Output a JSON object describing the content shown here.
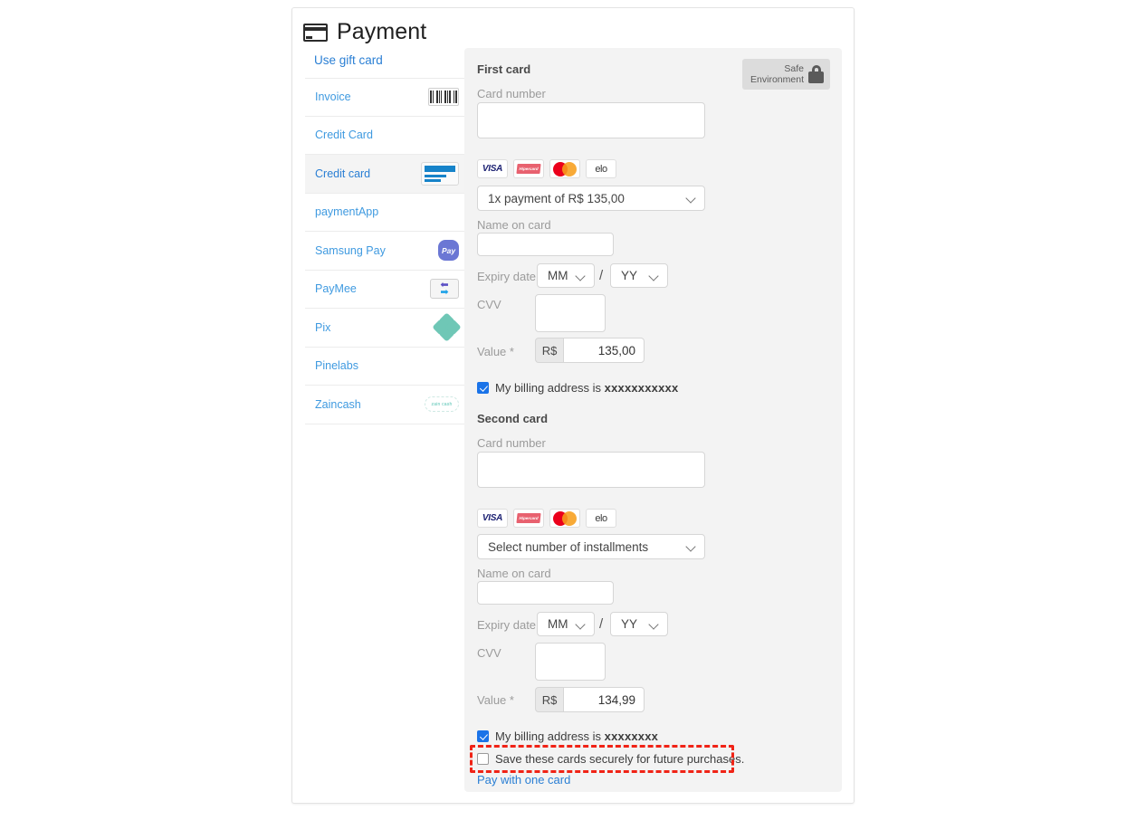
{
  "header": {
    "title": "Payment",
    "icon": "credit-card-icon"
  },
  "gift_card_link": "Use gift card",
  "sidebar": {
    "items": [
      {
        "label": "Invoice",
        "icon": "barcode-icon",
        "selected": false
      },
      {
        "label": "Credit Card",
        "icon": "none",
        "selected": false
      },
      {
        "label": "Credit card",
        "icon": "credit-card-icon",
        "selected": true
      },
      {
        "label": "paymentApp",
        "icon": "none",
        "selected": false
      },
      {
        "label": "Samsung Pay",
        "icon": "samsung-pay-icon",
        "icon_text": "Pay",
        "selected": false
      },
      {
        "label": "PayMee",
        "icon": "paymee-arrows-icon",
        "selected": false
      },
      {
        "label": "Pix",
        "icon": "pix-icon",
        "selected": false
      },
      {
        "label": "Pinelabs",
        "icon": "none",
        "selected": false
      },
      {
        "label": "Zaincash",
        "icon": "zaincash-icon",
        "icon_text": "zain cash",
        "selected": false
      }
    ]
  },
  "safe_badge": {
    "line1": "Safe",
    "line2": "Environment",
    "icon": "lock-icon"
  },
  "brands": [
    {
      "name": "visa-logo",
      "text": "VISA"
    },
    {
      "name": "hipercard-logo",
      "text": "Hipercard"
    },
    {
      "name": "mastercard-logo",
      "text": ""
    },
    {
      "name": "elo-logo",
      "text": "elo"
    }
  ],
  "first_card": {
    "title": "First card",
    "card_number_label": "Card number",
    "card_number_value": "",
    "selected_brand_index": 0,
    "installments_value": "1x payment of R$ 135,00",
    "name_label": "Name on card",
    "name_value": "",
    "expiry_label": "Expiry date",
    "expiry_month": "MM",
    "expiry_year": "YY",
    "expiry_separator": "/",
    "cvv_label": "CVV",
    "cvv_value": "",
    "value_label": "Value *",
    "currency_prefix": "R$",
    "value_amount": "135,00",
    "billing_checkbox_prefix": "My billing address is ",
    "billing_checkbox_masked": "xxxxxxxxxxx",
    "billing_checked": true
  },
  "second_card": {
    "title": "Second card",
    "card_number_label": "Card number",
    "card_number_value": "",
    "selected_brand_index": 0,
    "installments_value": "Select number of installments",
    "name_label": "Name on card",
    "name_value": "",
    "expiry_label": "Expiry date",
    "expiry_month": "MM",
    "expiry_year": "YY",
    "expiry_separator": "/",
    "cvv_label": "CVV",
    "cvv_value": "",
    "value_label": "Value *",
    "currency_prefix": "R$",
    "value_amount": "134,99",
    "billing_checkbox_prefix": "My billing address is ",
    "billing_checkbox_masked": "xxxxxxxx",
    "billing_checked": true
  },
  "save_cards": {
    "label": "Save these cards securely for future purchases.",
    "checked": false,
    "highlighted": true
  },
  "pay_with_one_card_link": "Pay with one card",
  "colors": {
    "link": "#2a7fd4",
    "accent": "#1a73e8",
    "highlight": "#f02316",
    "panel_bg": "#f3f3f3"
  }
}
